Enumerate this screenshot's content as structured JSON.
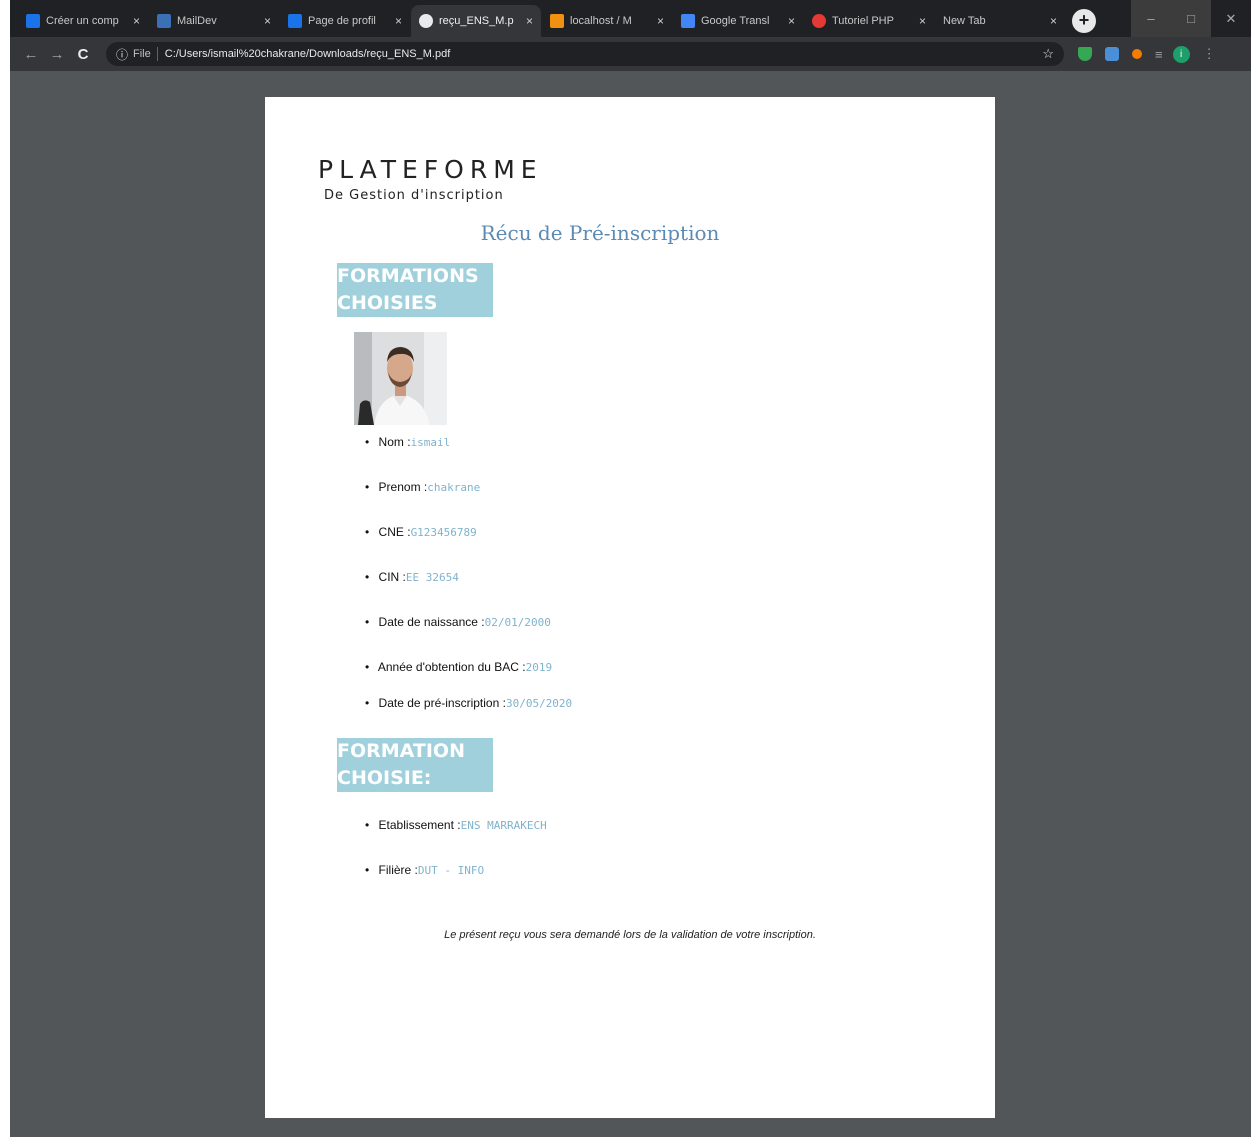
{
  "browser": {
    "tabs": [
      {
        "label": "Créer un comp",
        "favicon_color": "#1a73e8",
        "active": false
      },
      {
        "label": "MailDev",
        "favicon_color": "#3b6fb6",
        "active": false
      },
      {
        "label": "Page de profil",
        "favicon_color": "#1a73e8",
        "active": false
      },
      {
        "label": "reçu_ENS_M.p",
        "favicon_color": "#e8eaed",
        "active": true
      },
      {
        "label": "localhost / M",
        "favicon_color": "#f29111",
        "active": false
      },
      {
        "label": "Google Transl",
        "favicon_color": "#4285f4",
        "active": false
      },
      {
        "label": "Tutoriel PHP",
        "favicon_color": "#e53935",
        "active": false
      },
      {
        "label": "New Tab",
        "favicon_color": "",
        "active": false
      }
    ],
    "close_glyph": "×",
    "new_tab_glyph": "+",
    "nav": {
      "back": "←",
      "forward": "→",
      "reload": "C"
    },
    "address": {
      "info_glyph": "ⓘ",
      "scheme": "File",
      "url": "C:/Users/ismail%20chakrane/Downloads/reçu_ENS_M.pdf",
      "star_glyph": "☆"
    },
    "extensions": [
      {
        "icon": "shield-icon",
        "color": "#34a853"
      },
      {
        "icon": "translate-icon",
        "color": "#4a90d9"
      },
      {
        "icon": "fox-icon",
        "color": "#f57c00"
      }
    ],
    "profile_initial": "i",
    "profile_color": "#1e9e6a"
  },
  "document": {
    "brand_main": "PLATEFORME",
    "brand_sub": "De Gestion d'inscription",
    "title": "Récu de Pré-inscription",
    "section1": {
      "line1": "FORMATIONS",
      "line2": "CHOISIES"
    },
    "personal": [
      {
        "label": "Nom :",
        "value": "ismail"
      },
      {
        "label": "Prenom :",
        "value": "chakrane"
      },
      {
        "label": "CNE :",
        "value": "G123456789"
      },
      {
        "label": "CIN :",
        "value": "EE 32654"
      },
      {
        "label": "Date de naissance :",
        "value": "02/01/2000"
      },
      {
        "label": "Année d'obtention du BAC :",
        "value": "2019"
      },
      {
        "label": "Date de pré-inscription :",
        "value": "30/05/2020"
      }
    ],
    "section2": {
      "line1": "FORMATION",
      "line2": "CHOISIE:"
    },
    "formation": [
      {
        "label": "Etablissement :",
        "value": "ENS MARRAKECH"
      },
      {
        "label": "Filière :",
        "value": "DUT - INFO"
      }
    ],
    "footer_note": "Le présent reçu vous sera demandé lors de la validation de votre inscription."
  },
  "colors": {
    "accent_title": "#5b8bb5",
    "section_bg": "#9fd0dc",
    "value_text": "#7fb3cc",
    "viewer_bg": "#525659"
  }
}
